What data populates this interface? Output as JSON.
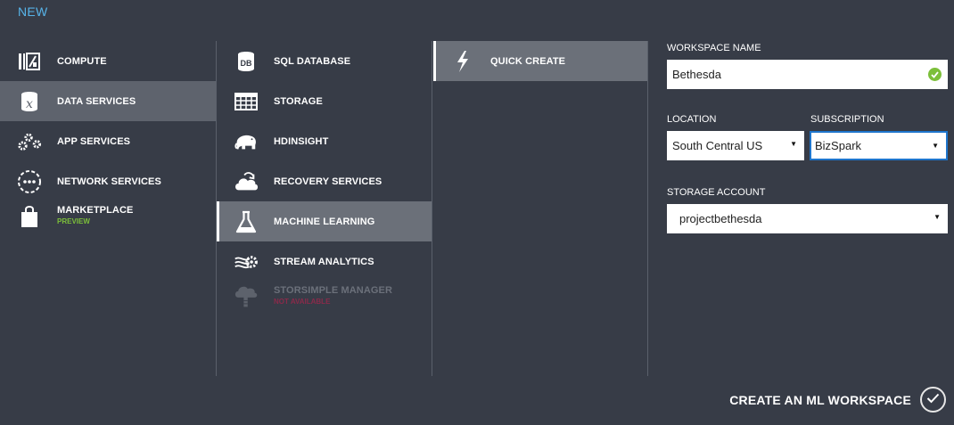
{
  "header": {
    "title": "NEW"
  },
  "categories": [
    {
      "label": "COMPUTE",
      "icon": "compute-icon"
    },
    {
      "label": "DATA SERVICES",
      "icon": "data-services-icon",
      "selected": true
    },
    {
      "label": "APP SERVICES",
      "icon": "app-services-icon"
    },
    {
      "label": "NETWORK SERVICES",
      "icon": "network-services-icon"
    },
    {
      "label": "MARKETPLACE",
      "sublabel": "PREVIEW",
      "icon": "marketplace-icon"
    }
  ],
  "services": [
    {
      "label": "SQL DATABASE",
      "icon": "sql-database-icon"
    },
    {
      "label": "STORAGE",
      "icon": "storage-icon"
    },
    {
      "label": "HDINSIGHT",
      "icon": "hdinsight-elephant-icon"
    },
    {
      "label": "RECOVERY SERVICES",
      "icon": "recovery-services-icon"
    },
    {
      "label": "MACHINE LEARNING",
      "icon": "machine-learning-flask-icon",
      "selected": true
    },
    {
      "label": "STREAM ANALYTICS",
      "icon": "stream-analytics-icon"
    },
    {
      "label": "STORSIMPLE MANAGER",
      "sublabel": "NOT AVAILABLE",
      "icon": "storsimple-cloud-icon",
      "disabled": true
    }
  ],
  "actions": [
    {
      "label": "QUICK CREATE",
      "icon": "lightning-bolt-icon",
      "selected": true
    }
  ],
  "form": {
    "workspace_name": {
      "label": "WORKSPACE NAME",
      "value": "Bethesda",
      "valid": true
    },
    "location": {
      "label": "LOCATION",
      "value": "South Central US"
    },
    "subscription": {
      "label": "SUBSCRIPTION",
      "value": "BizSpark"
    },
    "storage_account": {
      "label": "STORAGE ACCOUNT",
      "value": "projectbethesda"
    }
  },
  "footer": {
    "create_label": "CREATE AN ML WORKSPACE"
  },
  "colors": {
    "background": "#373c47",
    "accent_blue": "#57b4e9",
    "preview_green": "#7cbf3a",
    "valid_green": "#7cbf3a",
    "not_available": "#8a2a4a",
    "selected_bg": "#5e636d"
  }
}
